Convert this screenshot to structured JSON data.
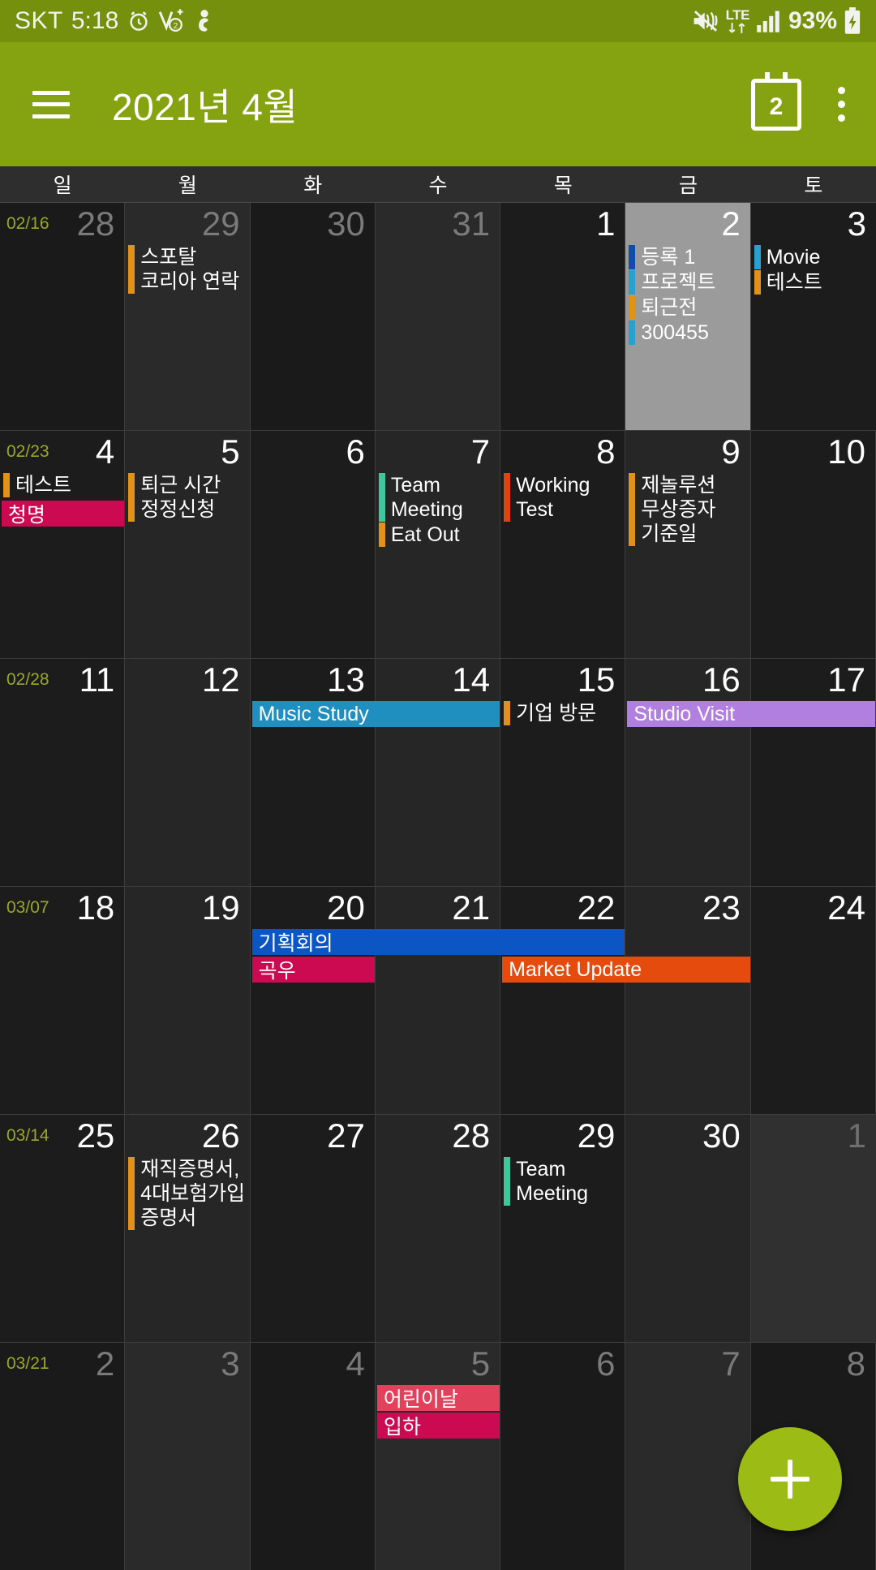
{
  "status_bar": {
    "carrier": "SKT",
    "time": "5:18",
    "icons_left": [
      "alarm-icon",
      "volume-plus-2-icon",
      "person-icon"
    ],
    "icons_right": [
      "mute-vibrate-icon",
      "lte-icon",
      "signal-bars-icon"
    ],
    "lte_label": "LTE",
    "battery_percent": "93%",
    "battery_state": "charging",
    "background": "#74900c"
  },
  "app_bar": {
    "menu_icon": "hamburger-menu-icon",
    "title": "2021년 4월",
    "today_icon": "calendar-day-icon",
    "today_number": "2",
    "overflow_icon": "overflow-menu-icon",
    "background": "#85a310"
  },
  "weekdays": [
    "일",
    "월",
    "화",
    "수",
    "목",
    "금",
    "토"
  ],
  "fab": {
    "label": "+",
    "name": "add-event-button",
    "color": "#9cbc15"
  },
  "colors": {
    "orange": "#e2911b",
    "dark_blue": "#0d4ea8",
    "light_blue": "#29a0d0",
    "cyan": "#1f8fc0",
    "teal": "#3fc69a",
    "red_orange": "#dd4411",
    "crimson": "#cc0a52",
    "purple": "#b07fe0",
    "blue_block": "#0b55c4",
    "orange_block": "#e44b0d",
    "week_label": "#9aa828",
    "selected_bg": "#9b9b9b"
  },
  "weeks": [
    {
      "week_label": "02/16",
      "days": [
        {
          "num": "28",
          "out": true,
          "events": []
        },
        {
          "num": "29",
          "out": true,
          "events": [
            {
              "title": "스포탈\n코리아 연락",
              "bar": "#e2911b",
              "style": "bar"
            }
          ]
        },
        {
          "num": "30",
          "out": true,
          "events": []
        },
        {
          "num": "31",
          "out": true,
          "events": []
        },
        {
          "num": "1",
          "out": false,
          "events": []
        },
        {
          "num": "2",
          "out": false,
          "selected": true,
          "events": [
            {
              "title": "등록 1",
              "bar": "#0d4ea8",
              "style": "bar"
            },
            {
              "title": "프로젝트",
              "bar": "#29a0d0",
              "style": "bar"
            },
            {
              "title": "퇴근전",
              "bar": "#e2911b",
              "style": "bar"
            },
            {
              "title": "300455",
              "bar": "#29a0d0",
              "style": "bar"
            }
          ]
        },
        {
          "num": "3",
          "out": false,
          "events": [
            {
              "title": "Movie",
              "bar": "#29a0d0",
              "style": "bar"
            },
            {
              "title": "테스트",
              "bar": "#e2911b",
              "style": "bar"
            }
          ]
        }
      ],
      "spans": []
    },
    {
      "week_label": "02/23",
      "days": [
        {
          "num": "4",
          "out": false,
          "events": [
            {
              "title": "테스트",
              "bar": "#e2911b",
              "style": "bar"
            }
          ]
        },
        {
          "num": "5",
          "out": false,
          "events": [
            {
              "title": "퇴근 시간\n정정신청",
              "bar": "#e2911b",
              "style": "bar"
            }
          ]
        },
        {
          "num": "6",
          "out": false,
          "events": []
        },
        {
          "num": "7",
          "out": false,
          "events": [
            {
              "title": "Team\nMeeting",
              "bar": "#3fc69a",
              "style": "bar"
            },
            {
              "title": "Eat Out",
              "bar": "#e2911b",
              "style": "bar"
            }
          ]
        },
        {
          "num": "8",
          "out": false,
          "events": [
            {
              "title": "Working\nTest",
              "bar": "#dd4411",
              "style": "bar"
            }
          ]
        },
        {
          "num": "9",
          "out": false,
          "events": [
            {
              "title": "제놀루션\n무상증자\n기준일",
              "bar": "#e2911b",
              "style": "bar"
            }
          ]
        },
        {
          "num": "10",
          "out": false,
          "events": []
        }
      ],
      "spans": [
        {
          "title": "청명",
          "color": "#cc0a52",
          "start": 0,
          "len": 1,
          "row": 1
        }
      ]
    },
    {
      "week_label": "02/28",
      "days": [
        {
          "num": "11",
          "out": false,
          "events": []
        },
        {
          "num": "12",
          "out": false,
          "events": []
        },
        {
          "num": "13",
          "out": false,
          "events": []
        },
        {
          "num": "14",
          "out": false,
          "events": []
        },
        {
          "num": "15",
          "out": false,
          "events": [
            {
              "title": "기업 방문",
              "bar": "#e2911b",
              "style": "bar"
            }
          ]
        },
        {
          "num": "16",
          "out": false,
          "events": []
        },
        {
          "num": "17",
          "out": false,
          "events": []
        }
      ],
      "spans": [
        {
          "title": "Music Study",
          "color": "#1f8fc0",
          "start": 2,
          "len": 2,
          "row": 0
        },
        {
          "title": "Studio Visit",
          "color": "#b07fe0",
          "start": 5,
          "len": 2,
          "row": 0
        }
      ]
    },
    {
      "week_label": "03/07",
      "days": [
        {
          "num": "18",
          "out": false,
          "events": []
        },
        {
          "num": "19",
          "out": false,
          "events": []
        },
        {
          "num": "20",
          "out": false,
          "events": []
        },
        {
          "num": "21",
          "out": false,
          "events": []
        },
        {
          "num": "22",
          "out": false,
          "events": []
        },
        {
          "num": "23",
          "out": false,
          "events": []
        },
        {
          "num": "24",
          "out": false,
          "events": []
        }
      ],
      "spans": [
        {
          "title": "기획회의",
          "color": "#0b55c4",
          "start": 2,
          "len": 3,
          "row": 0
        },
        {
          "title": "곡우",
          "color": "#cc0a52",
          "start": 2,
          "len": 1,
          "row": 1
        },
        {
          "title": "Market Update",
          "color": "#e44b0d",
          "start": 4,
          "len": 2,
          "row": 1
        }
      ]
    },
    {
      "week_label": "03/14",
      "days": [
        {
          "num": "25",
          "out": false,
          "events": []
        },
        {
          "num": "26",
          "out": false,
          "events": [
            {
              "title": "재직증명서,\n4대보험가입\n증명서",
              "bar": "#e2911b",
              "style": "bar"
            }
          ]
        },
        {
          "num": "27",
          "out": false,
          "events": []
        },
        {
          "num": "28",
          "out": false,
          "events": []
        },
        {
          "num": "29",
          "out": false,
          "events": [
            {
              "title": "Team\nMeeting",
              "bar": "#3fc69a",
              "style": "bar"
            }
          ]
        },
        {
          "num": "30",
          "out": false,
          "events": []
        },
        {
          "num": "1",
          "out": false,
          "trailing": true,
          "events": []
        }
      ],
      "spans": []
    },
    {
      "week_label": "03/21",
      "days": [
        {
          "num": "2",
          "out": true,
          "events": []
        },
        {
          "num": "3",
          "out": true,
          "events": []
        },
        {
          "num": "4",
          "out": true,
          "events": []
        },
        {
          "num": "5",
          "out": true,
          "events": []
        },
        {
          "num": "6",
          "out": true,
          "events": []
        },
        {
          "num": "7",
          "out": true,
          "events": []
        },
        {
          "num": "8",
          "out": true,
          "events": []
        }
      ],
      "spans": [
        {
          "title": "어린이날",
          "color": "#e2415c",
          "start": 3,
          "len": 1,
          "row": 0
        },
        {
          "title": "입하",
          "color": "#cc0a52",
          "start": 3,
          "len": 1,
          "row": 1
        }
      ]
    }
  ]
}
